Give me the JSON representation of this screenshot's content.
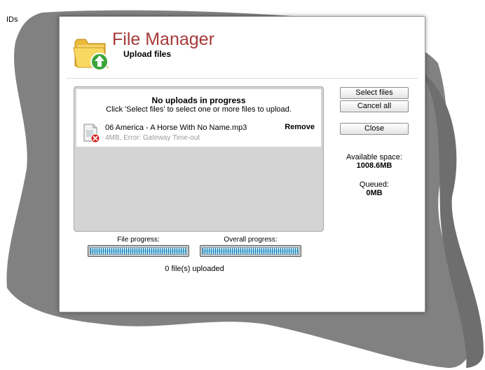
{
  "corner_label": "IDs",
  "header": {
    "title": "File Manager",
    "subtitle": "Upload files",
    "icon": "folder-upload-icon"
  },
  "upload_list": {
    "status_title": "No uploads in progress",
    "status_hint": "Click 'Select files' to select one or more files to upload.",
    "files": [
      {
        "name": "06 America - A Horse With No Name.mp3",
        "meta": "4MB, Error: Gateway Time-out",
        "icon": "file-error-icon",
        "remove_label": "Remove"
      }
    ]
  },
  "buttons": {
    "select_files": "Select files",
    "cancel_all": "Cancel all",
    "close": "Close"
  },
  "space": {
    "available_label": "Available space:",
    "available_value": "1008.6MB",
    "queued_label": "Queued:",
    "queued_value": "0MB"
  },
  "progress": {
    "file_label": "File progress:",
    "file_value": 0,
    "overall_label": "Overall progress:",
    "overall_value": 0,
    "uploaded_text": "0 file(s) uploaded"
  },
  "colors": {
    "title": "#a53a3a",
    "shadow": "#7a7a7a",
    "upload_area_bg": "#d4d4d4"
  }
}
